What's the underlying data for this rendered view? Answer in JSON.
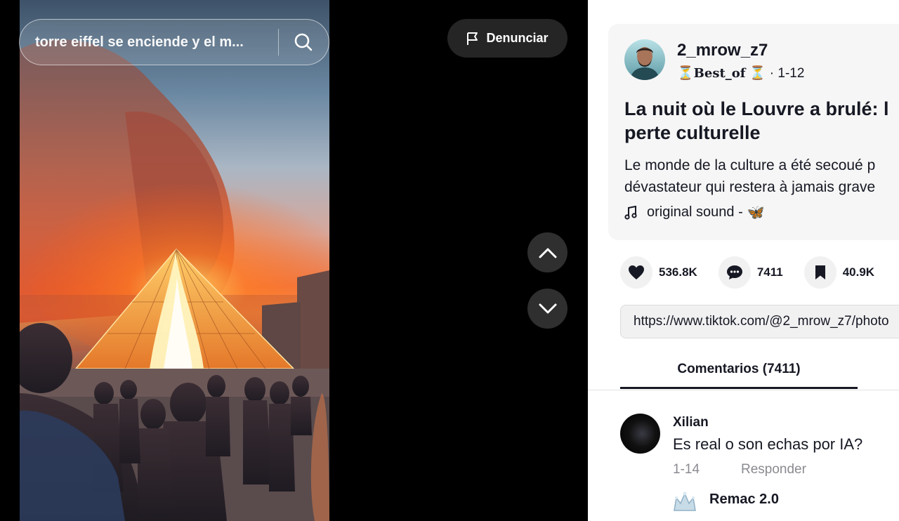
{
  "search": {
    "query": "torre eiffel se enciende y el m...",
    "icon": "search-icon"
  },
  "report": {
    "label": "Denunciar",
    "icon": "flag-icon"
  },
  "navigation": {
    "prev_icon": "chevron-up-icon",
    "next_icon": "chevron-down-icon"
  },
  "post": {
    "username": "2_mrow_z7",
    "badge": "Best_of",
    "date": "1-12",
    "title": "La nuit où le Louvre a brulé: l",
    "title_line2": "perte culturelle",
    "desc_line1": "Le monde de la culture a été secoué p",
    "desc_line2": "dévastateur qui restera à jamais grave",
    "sound": "original sound -",
    "sound_emoji": "🦋"
  },
  "stats": {
    "likes": "536.8K",
    "comments": "7411",
    "saves": "40.9K"
  },
  "share_url": "https://www.tiktok.com/@2_mrow_z7/photo",
  "tabs": {
    "comments": "Comentarios (7411)"
  },
  "comments": [
    {
      "user": "Xilian",
      "text": "Es real o son echas por IA?",
      "date": "1-14",
      "reply": "Responder"
    },
    {
      "user": "Remac 2.0"
    }
  ],
  "colors": {
    "text": "#161823",
    "muted": "#8a8b91",
    "panel_bg": "#ffffff",
    "card_bg": "#f6f6f6"
  }
}
